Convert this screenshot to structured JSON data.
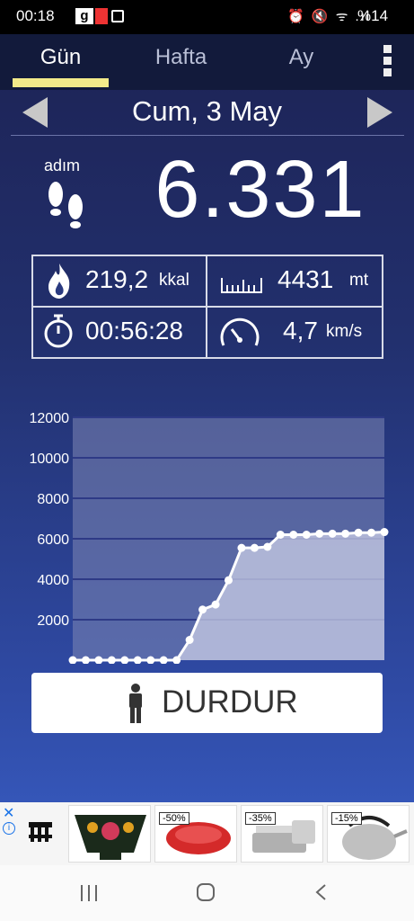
{
  "status_bar": {
    "time": "00:18",
    "notif_label": "g",
    "sys_icons": "⏰ 🔇 ᯤ .ıl",
    "battery": "%14"
  },
  "tabs": [
    {
      "label": "Gün",
      "active": true
    },
    {
      "label": "Hafta",
      "active": false
    },
    {
      "label": "Ay",
      "active": false
    }
  ],
  "date": "Cum, 3 May",
  "steps": {
    "label": "adım",
    "value": "6.331"
  },
  "stats": {
    "calories": {
      "value": "219,2",
      "unit": "kkal",
      "icon": "flame-icon"
    },
    "distance": {
      "value": "4431",
      "unit": "mt",
      "icon": "ruler-icon"
    },
    "duration": {
      "value": "00:56:28",
      "icon": "stopwatch-icon"
    },
    "speed": {
      "value": "4,7",
      "unit": "km/s",
      "icon": "speedometer-icon"
    }
  },
  "chart_data": {
    "type": "area",
    "x": [
      0,
      1,
      2,
      3,
      4,
      5,
      6,
      7,
      8,
      9,
      10,
      11,
      12,
      13,
      14,
      15,
      16,
      17,
      18,
      19,
      20,
      21,
      22,
      23,
      24
    ],
    "values": [
      0,
      0,
      0,
      0,
      0,
      0,
      0,
      0,
      0,
      1000,
      2500,
      2750,
      3950,
      5550,
      5550,
      5600,
      6200,
      6200,
      6200,
      6250,
      6250,
      6250,
      6300,
      6300,
      6331
    ],
    "xticks": [
      "2",
      "4",
      "6",
      "8",
      "10",
      "12",
      "14",
      "16",
      "18",
      "20",
      "22",
      "24"
    ],
    "yticks": [
      "2000",
      "4000",
      "6000",
      "8000",
      "10000",
      "12000"
    ],
    "ylim": [
      0,
      12000
    ],
    "xlim": [
      0,
      24
    ]
  },
  "stop_button": {
    "label": "DURDUR"
  },
  "ad": {
    "close": "✕",
    "info": "i",
    "badges": [
      "-50%",
      "-35%",
      "-15%"
    ]
  },
  "colors": {
    "tab_indicator": "#f3ea8a",
    "background_top": "#1d2355",
    "background_bottom": "#3556b8"
  }
}
